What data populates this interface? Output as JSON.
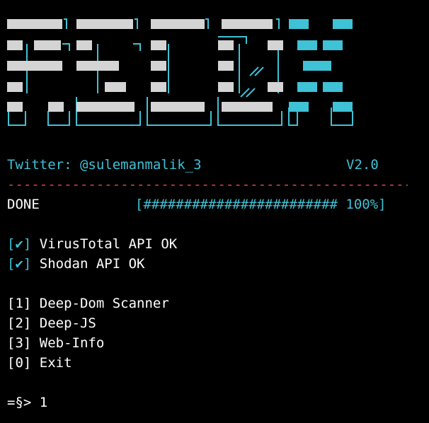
{
  "banner": {
    "logo_text": "FSCDX",
    "colors": {
      "blocks": "#d4d4d4",
      "accent": "#3fc1d6"
    }
  },
  "header": {
    "twitter": "Twitter: @sulemanmalik_3",
    "version": "V2.0",
    "divider": "----------------------------------------------------------------------"
  },
  "status": {
    "label": "DONE",
    "progress_text": "[######################## 100%]",
    "progress_percent": 100
  },
  "checks": [
    {
      "mark": "[✔]",
      "text": " VirusTotal API OK"
    },
    {
      "mark": "[✔]",
      "text": " Shodan API OK"
    }
  ],
  "menu": [
    {
      "key": "[1]",
      "label": " Deep-Dom Scanner"
    },
    {
      "key": "[2]",
      "label": " Deep-JS"
    },
    {
      "key": "[3]",
      "label": " Web-Info"
    },
    {
      "key": "[0]",
      "label": " Exit"
    }
  ],
  "prompt": {
    "symbol": "=§>",
    "input": " 1"
  },
  "colors": {
    "background": "#000000",
    "text": "#ffffff",
    "accent": "#3fc1d6",
    "divider": "#e0473a"
  }
}
